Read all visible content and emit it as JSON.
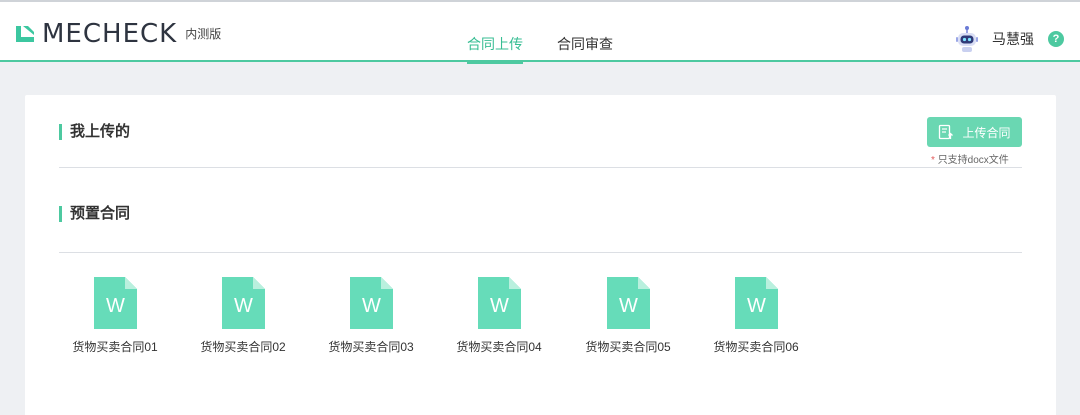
{
  "header": {
    "logo_text": "MECHECK",
    "edition": "内测版",
    "tabs": [
      {
        "label": "合同上传",
        "active": true
      },
      {
        "label": "合同审查",
        "active": false
      }
    ],
    "user": {
      "name": "马慧强",
      "help_icon": "?"
    }
  },
  "my_uploads": {
    "title": "我上传的",
    "upload_button": "上传合同",
    "hint_star": "*",
    "hint_text": "只支持docx文件"
  },
  "preset": {
    "title": "预置合同",
    "files": [
      {
        "name": "货物买卖合同01",
        "icon_letter": "W"
      },
      {
        "name": "货物买卖合同02",
        "icon_letter": "W"
      },
      {
        "name": "货物买卖合同03",
        "icon_letter": "W"
      },
      {
        "name": "货物买卖合同04",
        "icon_letter": "W"
      },
      {
        "name": "货物买卖合同05",
        "icon_letter": "W"
      },
      {
        "name": "货物买卖合同06",
        "icon_letter": "W"
      }
    ]
  },
  "colors": {
    "accent": "#4dc9a0",
    "button": "#6ad7b2",
    "file_icon": "#66dcb9",
    "background": "#eef0f3"
  }
}
